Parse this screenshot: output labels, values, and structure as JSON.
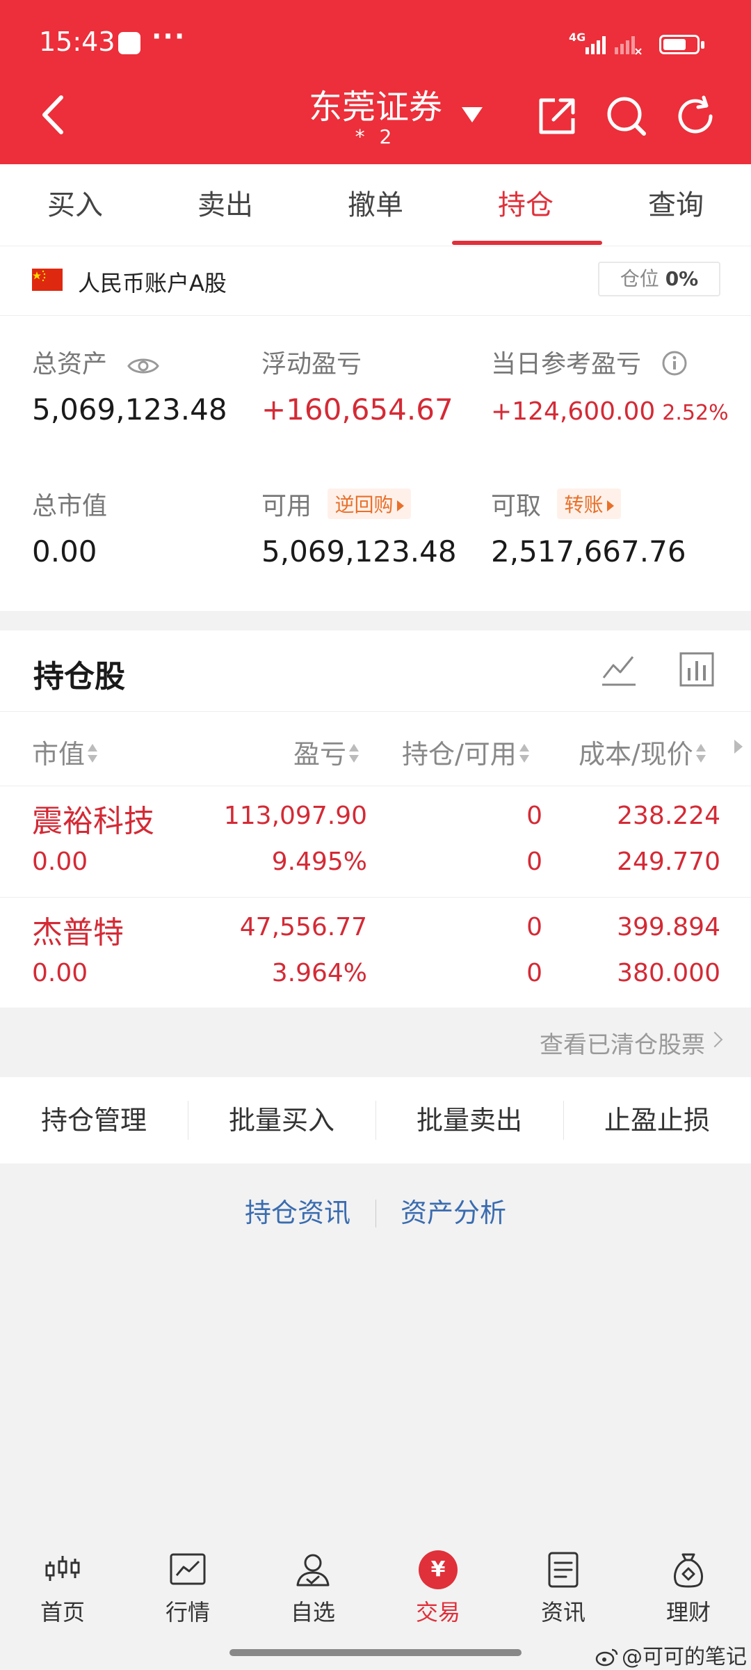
{
  "status_bar": {
    "time": "15:43",
    "dots": "···",
    "network": "4G",
    "battery_level": 0.7
  },
  "header": {
    "title": "东莞证券",
    "account_masked": "*     2"
  },
  "tabs": [
    {
      "label": "买入"
    },
    {
      "label": "卖出"
    },
    {
      "label": "撤单"
    },
    {
      "label": "持仓",
      "active": true
    },
    {
      "label": "查询"
    }
  ],
  "account": {
    "name": "人民币账户A股",
    "position_label": "仓位",
    "position_value": "0%"
  },
  "metrics": {
    "total_assets_label": "总资产",
    "total_assets": "5,069,123.48",
    "floating_pl_label": "浮动盈亏",
    "floating_pl": "+160,654.67",
    "daily_pl_label": "当日参考盈亏",
    "daily_pl": "+124,600.00",
    "daily_pl_pct": "2.52%",
    "market_value_label": "总市值",
    "market_value": "0.00",
    "available_label": "可用",
    "available": "5,069,123.48",
    "reverse_repo_tag": "逆回购",
    "withdrawable_label": "可取",
    "withdrawable": "2,517,667.76",
    "transfer_tag": "转账"
  },
  "holdings": {
    "title": "持仓股",
    "columns": [
      "市值",
      "盈亏",
      "持仓/可用",
      "成本/现价"
    ],
    "rows": [
      {
        "name": "震裕科技",
        "market_value": "0.00",
        "pl": "113,097.90",
        "pl_pct": "9.495%",
        "hold": "0",
        "available": "0",
        "cost": "238.224",
        "price": "249.770"
      },
      {
        "name": "杰普特",
        "market_value": "0.00",
        "pl": "47,556.77",
        "pl_pct": "3.964%",
        "hold": "0",
        "available": "0",
        "cost": "399.894",
        "price": "380.000"
      }
    ],
    "view_cleared": "查看已清仓股票"
  },
  "actions": [
    "持仓管理",
    "批量买入",
    "批量卖出",
    "止盈止损"
  ],
  "links": [
    "持仓资讯",
    "资产分析"
  ],
  "bottom_nav": [
    {
      "label": "首页",
      "icon": "candlestick-icon"
    },
    {
      "label": "行情",
      "icon": "market-chart-icon"
    },
    {
      "label": "自选",
      "icon": "user-check-icon"
    },
    {
      "label": "交易",
      "icon": "yuan-icon",
      "active": true
    },
    {
      "label": "资讯",
      "icon": "news-icon"
    },
    {
      "label": "理财",
      "icon": "money-bag-icon"
    }
  ],
  "watermark": "@可可的笔记",
  "colors": {
    "brand_red": "#ec2f3a",
    "profit_red": "#d42a35",
    "tag_orange": "#e8702a",
    "link_blue": "#3a6cb0"
  }
}
